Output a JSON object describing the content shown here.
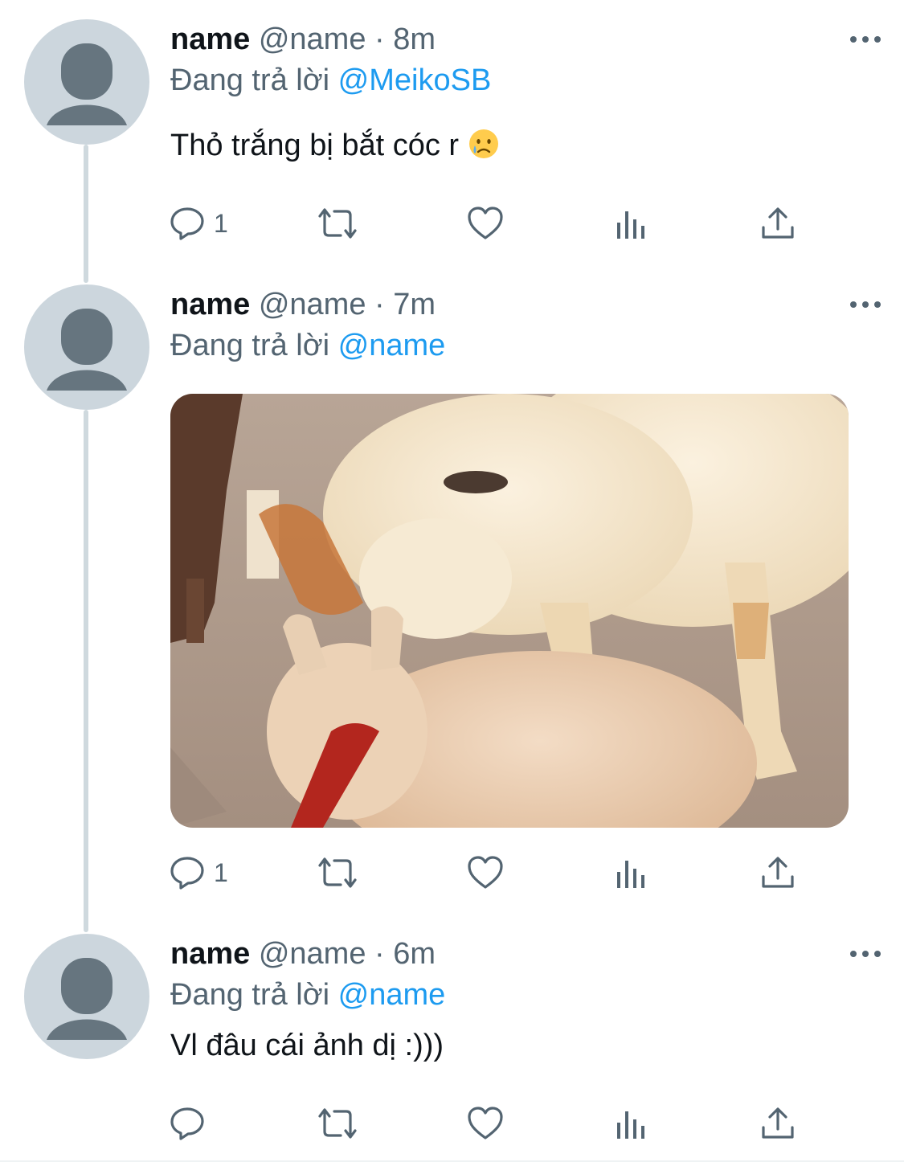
{
  "tweets": [
    {
      "display_name": "name",
      "handle": "@name",
      "separator": "·",
      "time": "8m",
      "reply_prefix": "Đang trả lời",
      "reply_to": "@MeikoSB",
      "text": "Thỏ trắng bị bắt cóc r",
      "emoji": "crying-face-emoji",
      "reply_count": "1",
      "has_media": false
    },
    {
      "display_name": "name",
      "handle": "@name",
      "separator": "·",
      "time": "7m",
      "reply_prefix": "Đang trả lời",
      "reply_to": "@name",
      "text": "",
      "media": "photo-alpaca-and-rabbit",
      "reply_count": "1",
      "has_media": true
    },
    {
      "display_name": "name",
      "handle": "@name",
      "separator": "·",
      "time": "6m",
      "reply_prefix": "Đang trả lời",
      "reply_to": "@name",
      "text": "Vl đâu cái ảnh dị :)))",
      "reply_count": "",
      "has_media": false
    }
  ],
  "icons": {
    "more": "more-horizontal-icon",
    "reply": "reply-icon",
    "retweet": "retweet-icon",
    "like": "heart-icon",
    "analytics": "analytics-icon",
    "share": "share-icon",
    "avatar": "default-avatar-icon"
  },
  "colors": {
    "link": "#1d9bf0",
    "secondary_text": "#536471",
    "primary_text": "#0f1419",
    "avatar_bg": "#ccd6dd",
    "avatar_fg": "#66757f",
    "thread_line": "#cfd9de"
  }
}
